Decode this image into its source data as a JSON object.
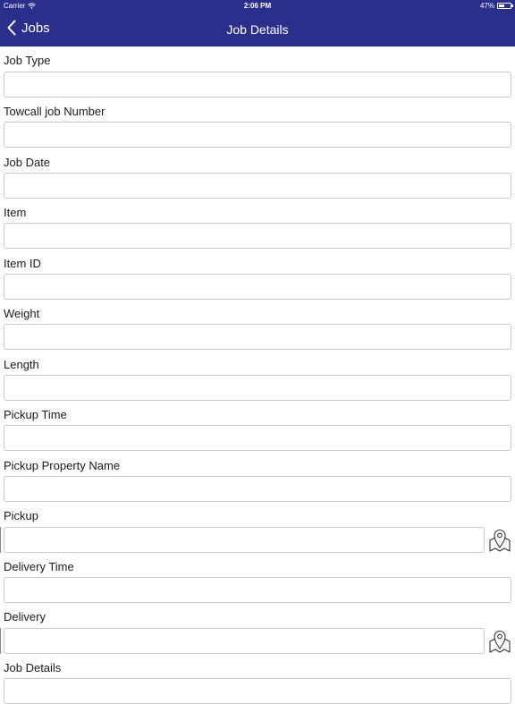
{
  "status_bar": {
    "carrier": "Carrier",
    "time": "2:06 PM",
    "battery": "47%",
    "battery_level": 0.47
  },
  "nav": {
    "back_label": "Jobs",
    "title": "Job Details"
  },
  "fields": {
    "job_type": {
      "label": "Job Type",
      "value": ""
    },
    "towcall_job_number": {
      "label": "Towcall job Number",
      "value": ""
    },
    "job_date": {
      "label": "Job Date",
      "value": ""
    },
    "item": {
      "label": "Item",
      "value": ""
    },
    "item_id": {
      "label": "Item ID",
      "value": ""
    },
    "weight": {
      "label": "Weight",
      "value": ""
    },
    "length": {
      "label": "Length",
      "value": ""
    },
    "pickup_time": {
      "label": "Pickup Time",
      "value": ""
    },
    "pickup_property_name": {
      "label": "Pickup Property Name",
      "value": ""
    },
    "pickup": {
      "label": "Pickup",
      "value": ""
    },
    "delivery_time": {
      "label": "Delivery Time",
      "value": ""
    },
    "delivery": {
      "label": "Delivery",
      "value": ""
    },
    "job_details": {
      "label": "Job Details",
      "value": ""
    }
  },
  "icons": {
    "back": "chevron-left-icon",
    "map": "map-pin-icon",
    "wifi": "wifi-icon"
  },
  "colors": {
    "nav_background": "#2b2f8c",
    "nav_text": "#ffffff",
    "input_border": "#c8c8c8"
  }
}
